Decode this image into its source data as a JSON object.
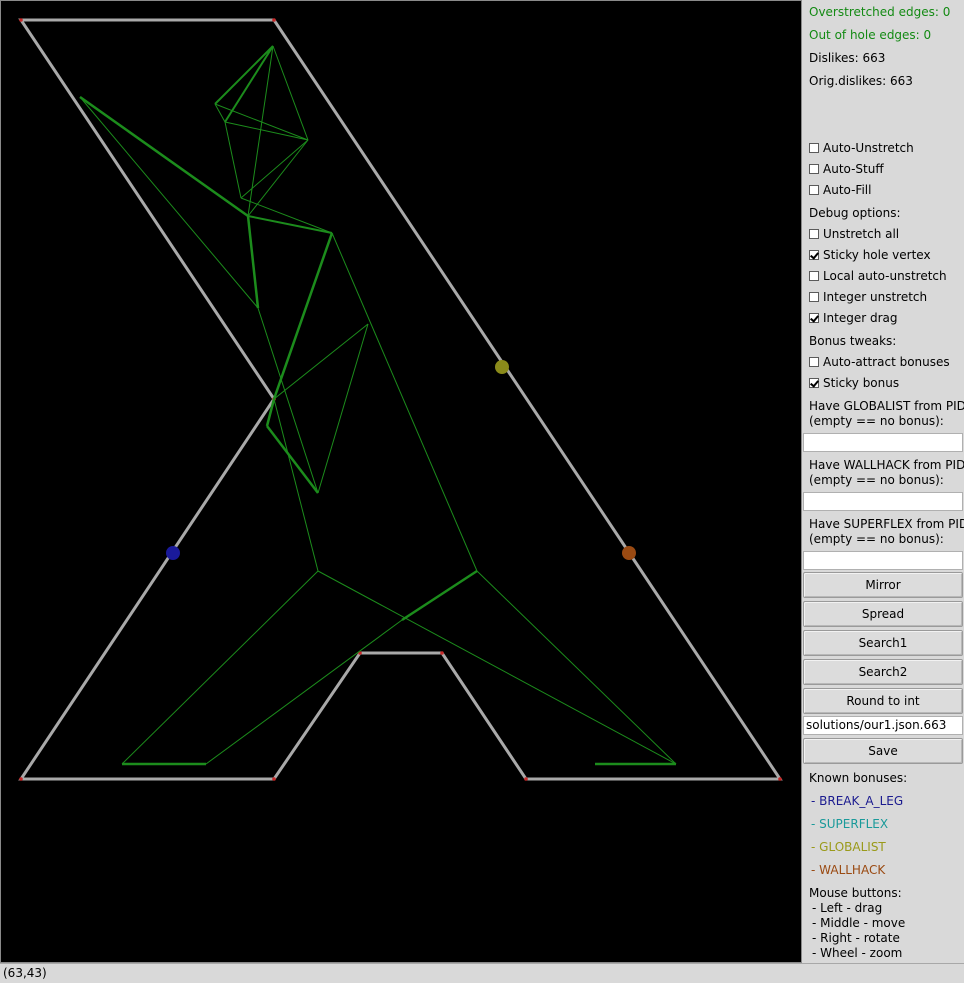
{
  "status": {
    "overstretched": "Overstretched edges: 0",
    "out_of_hole": "Out of hole edges: 0",
    "dislikes": "Dislikes: 663",
    "orig_dislikes": "Orig.dislikes: 663"
  },
  "options": {
    "auto_unstretch": {
      "label": "Auto-Unstretch",
      "checked": false
    },
    "auto_stuff": {
      "label": "Auto-Stuff",
      "checked": false
    },
    "auto_fill": {
      "label": "Auto-Fill",
      "checked": false
    },
    "debug_header": "Debug options:",
    "unstretch_all": {
      "label": "Unstretch all",
      "checked": false
    },
    "sticky_hole_vertex": {
      "label": "Sticky hole vertex",
      "checked": true
    },
    "local_auto_unstretch": {
      "label": "Local auto-unstretch",
      "checked": false
    },
    "integer_unstretch": {
      "label": "Integer unstretch",
      "checked": false
    },
    "integer_drag": {
      "label": "Integer drag",
      "checked": true
    },
    "bonus_header": "Bonus tweaks:",
    "auto_attract_bonuses": {
      "label": "Auto-attract bonuses",
      "checked": false
    },
    "sticky_bonus": {
      "label": "Sticky bonus",
      "checked": true
    }
  },
  "bonus_inputs": {
    "globalist_line1": "Have GLOBALIST from PID",
    "globalist_line2": "(empty == no bonus):",
    "globalist_value": "",
    "wallhack_line1": "Have WALLHACK from PID",
    "wallhack_line2": "(empty == no bonus):",
    "wallhack_value": "",
    "superflex_line1": "Have SUPERFLEX from PID",
    "superflex_line2": "(empty == no bonus):",
    "superflex_value": ""
  },
  "buttons": {
    "mirror": "Mirror",
    "spread": "Spread",
    "search1": "Search1",
    "search2": "Search2",
    "round_to_int": "Round to int",
    "save": "Save"
  },
  "save_path": "solutions/our1.json.663",
  "known_bonuses": {
    "header": "Known bonuses:",
    "items": [
      {
        "label": "- BREAK_A_LEG",
        "color": "#1b1b8f"
      },
      {
        "label": "- SUPERFLEX",
        "color": "#1a9a9a"
      },
      {
        "label": "- GLOBALIST",
        "color": "#9a9a1a"
      },
      {
        "label": "- WALLHACK",
        "color": "#9a4a12"
      }
    ]
  },
  "mouse_help": {
    "header": "Mouse buttons:",
    "left": "- Left - drag",
    "middle": "- Middle - move",
    "right": "- Right - rotate",
    "wheel": "- Wheel - zoom"
  },
  "coords": "(63,43)",
  "colors": {
    "hole": "#a9a9a9",
    "figure": "#1c8c1c",
    "globalist_marker": "#8a8a1a",
    "wallhack_marker": "#9a4a12",
    "break_a_leg_marker": "#1a1a9a"
  }
}
